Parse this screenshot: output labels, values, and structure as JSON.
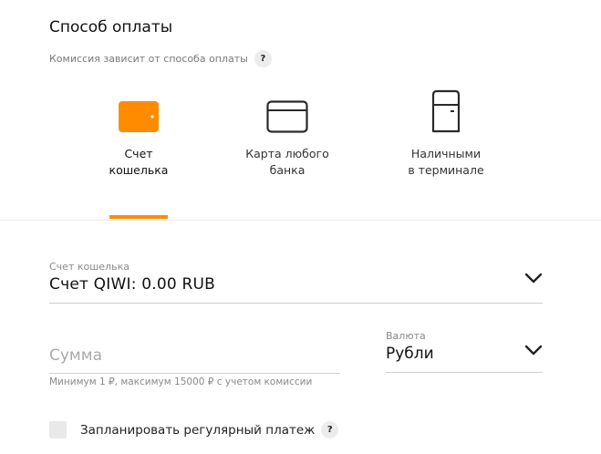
{
  "header": {
    "title": "Способ оплаты",
    "subtitle": "Комиссия зависит от способа оплаты",
    "help": "?"
  },
  "methods": [
    {
      "label": "Счет\nкошелька",
      "icon": "wallet-icon",
      "selected": true
    },
    {
      "label": "Карта любого\nбанка",
      "icon": "card-icon",
      "selected": false
    },
    {
      "label": "Наличными\nв терминале",
      "icon": "terminal-icon",
      "selected": false
    }
  ],
  "wallet_field": {
    "label": "Счет кошелька",
    "value": "Счет QIWI: 0.00 RUB"
  },
  "amount_field": {
    "placeholder": "Сумма",
    "hint": "Минимум 1 ₽, максимум 15000 ₽ с учетом комиссии"
  },
  "currency_field": {
    "label": "Валюта",
    "value": "Рубли"
  },
  "recurring": {
    "label": "Запланировать регулярный платеж",
    "checked": false,
    "help": "?"
  },
  "colors": {
    "accent": "#ff8c00",
    "divider": "#ededed"
  }
}
